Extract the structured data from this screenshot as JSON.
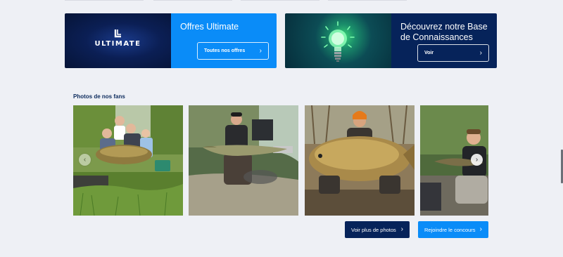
{
  "promos": [
    {
      "title": "Offres Ultimate",
      "logo_text": "ULTIMATE",
      "button_label": "Toutes nos offres",
      "button_icon": "chevron-right-icon",
      "color": "#0a8cf8"
    },
    {
      "title": "Découvrez notre Base de Connaissances",
      "button_label": "Voir",
      "button_icon": "chevron-right-icon",
      "color": "#06235a"
    }
  ],
  "fan_photos": {
    "title": "Photos de nos fans",
    "photos": [
      {
        "subject": "family-holding-carp"
      },
      {
        "subject": "angler-holding-pike"
      },
      {
        "subject": "angler-holding-common-carp"
      },
      {
        "subject": "boy-holding-fish"
      }
    ],
    "prev_icon": "chevron-left-icon",
    "next_icon": "chevron-right-icon",
    "more_label": "Voir plus de photos",
    "join_label": "Rejoindre le concours"
  },
  "colors": {
    "navy": "#06235a",
    "blue": "#0a8cf8",
    "background": "#eef0f5",
    "heading": "#0b2a5c"
  }
}
